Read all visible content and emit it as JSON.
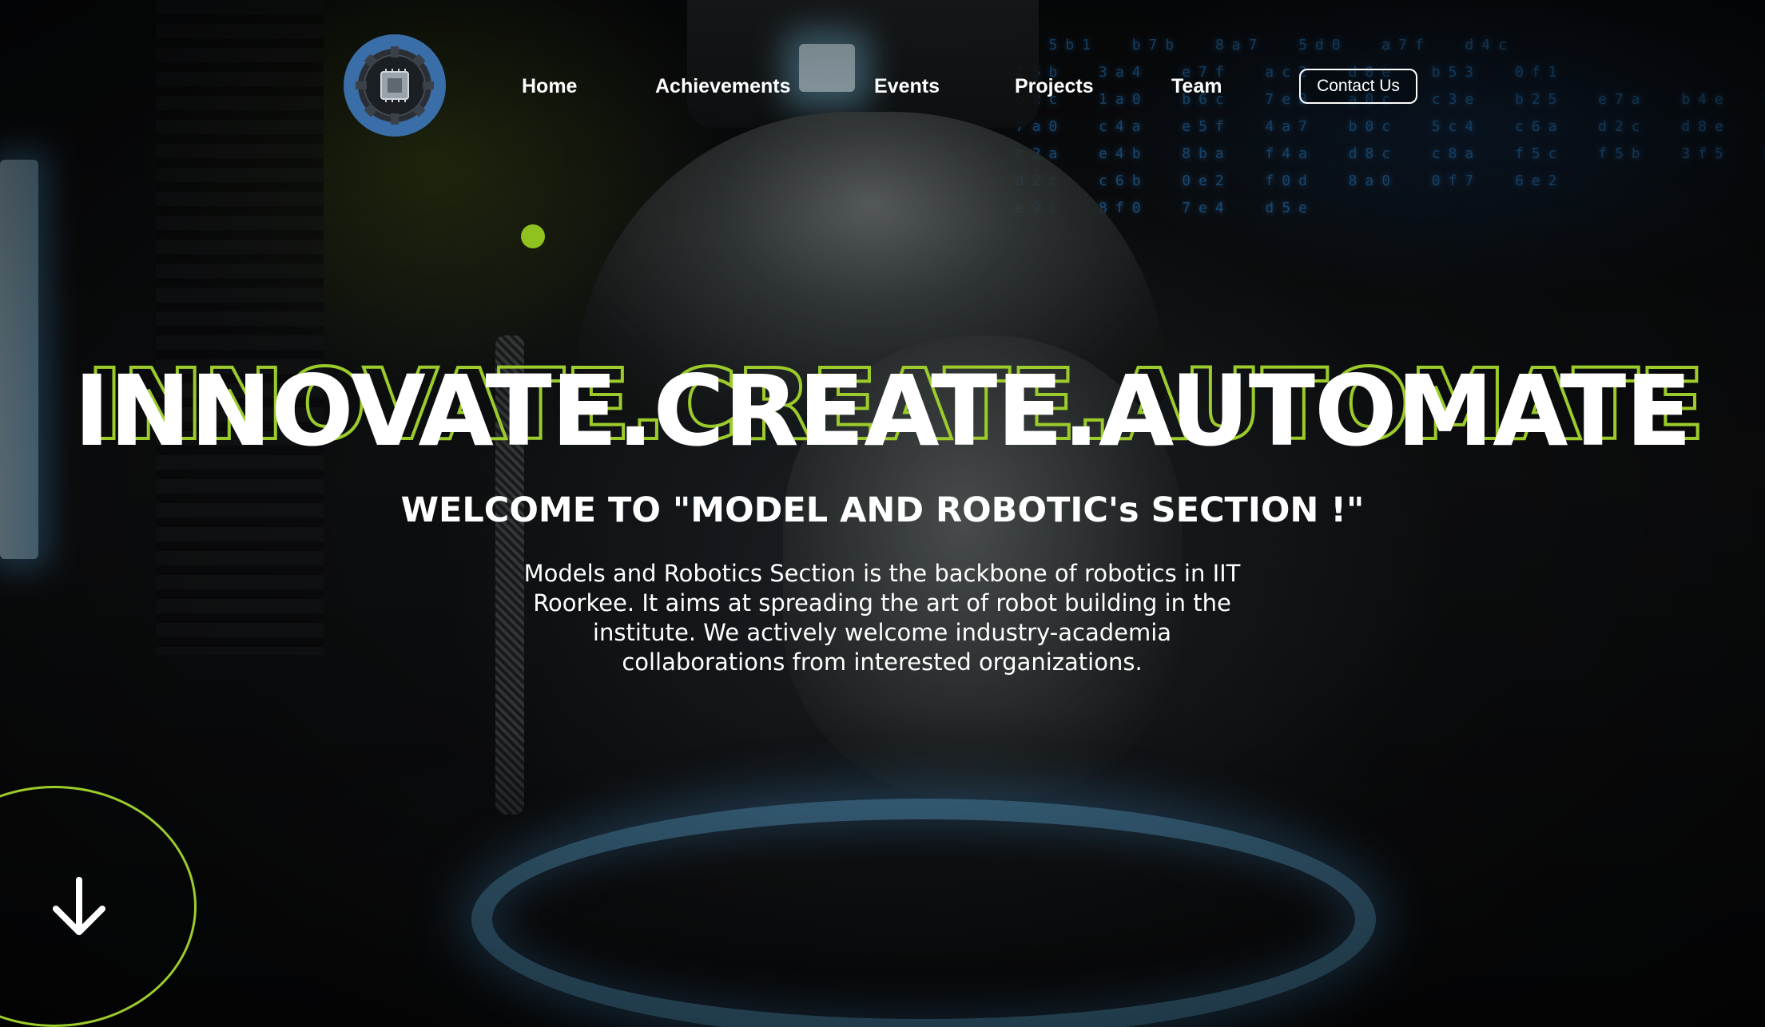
{
  "nav": {
    "items": [
      {
        "label": "Home"
      },
      {
        "label": "Achievements"
      },
      {
        "label": "Events"
      },
      {
        "label": "Projects"
      },
      {
        "label": "Team"
      }
    ],
    "contact_label": "Contact Us"
  },
  "logo": {
    "icon": "gear-chip-logo-icon"
  },
  "hero": {
    "headline": "INNOVATE.CREATE.AUTOMATE",
    "welcome": "WELCOME TO \"MODEL AND ROBOTIC's SECTION !\"",
    "description": "Models and Robotics Section is the backbone of robotics in IIT Roorkee. It aims at spreading the art of robot building in the institute. We actively welcome industry-academia collaborations from interested organizations."
  },
  "scroll": {
    "icon": "arrow-down-icon"
  },
  "colors": {
    "accent": "#9ccc2b",
    "text": "#ffffff",
    "logo_orange": "#f0902a",
    "logo_blue": "#3a6ea8"
  }
}
